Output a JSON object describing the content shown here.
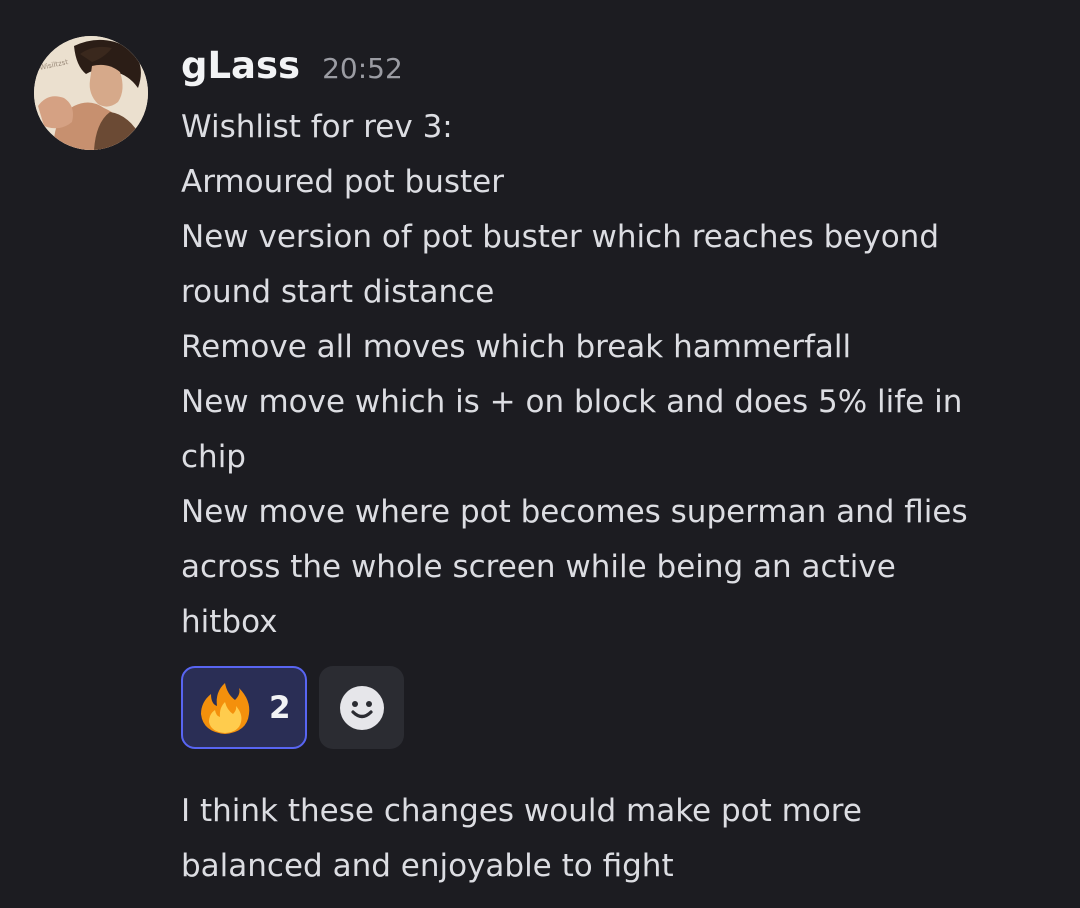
{
  "message": {
    "username": "gLass",
    "timestamp": "20:52",
    "lines": [
      "Wishlist for rev 3:",
      "Armoured pot buster",
      "New version of pot buster which reaches beyond",
      "round start distance",
      "Remove all moves which break hammerfall",
      "New move which is + on block and does 5% life in",
      "chip",
      "New move where pot becomes superman and flies",
      "across the whole screen while being an active",
      "hitbox"
    ],
    "reactions": [
      {
        "emoji": "fire-icon",
        "count": "2",
        "selected": true
      }
    ],
    "add_reaction_icon": "smiley-face-icon"
  },
  "followup": {
    "lines": [
      "I think these changes would make pot more",
      "balanced and enjoyable to fight"
    ]
  },
  "colors": {
    "background": "#1c1c21",
    "text": "#dcdde2",
    "username": "#f2f3f5",
    "timestamp": "#9b9ca3",
    "reaction_border": "#5865f2",
    "reaction_bg": "#2a2e55"
  }
}
